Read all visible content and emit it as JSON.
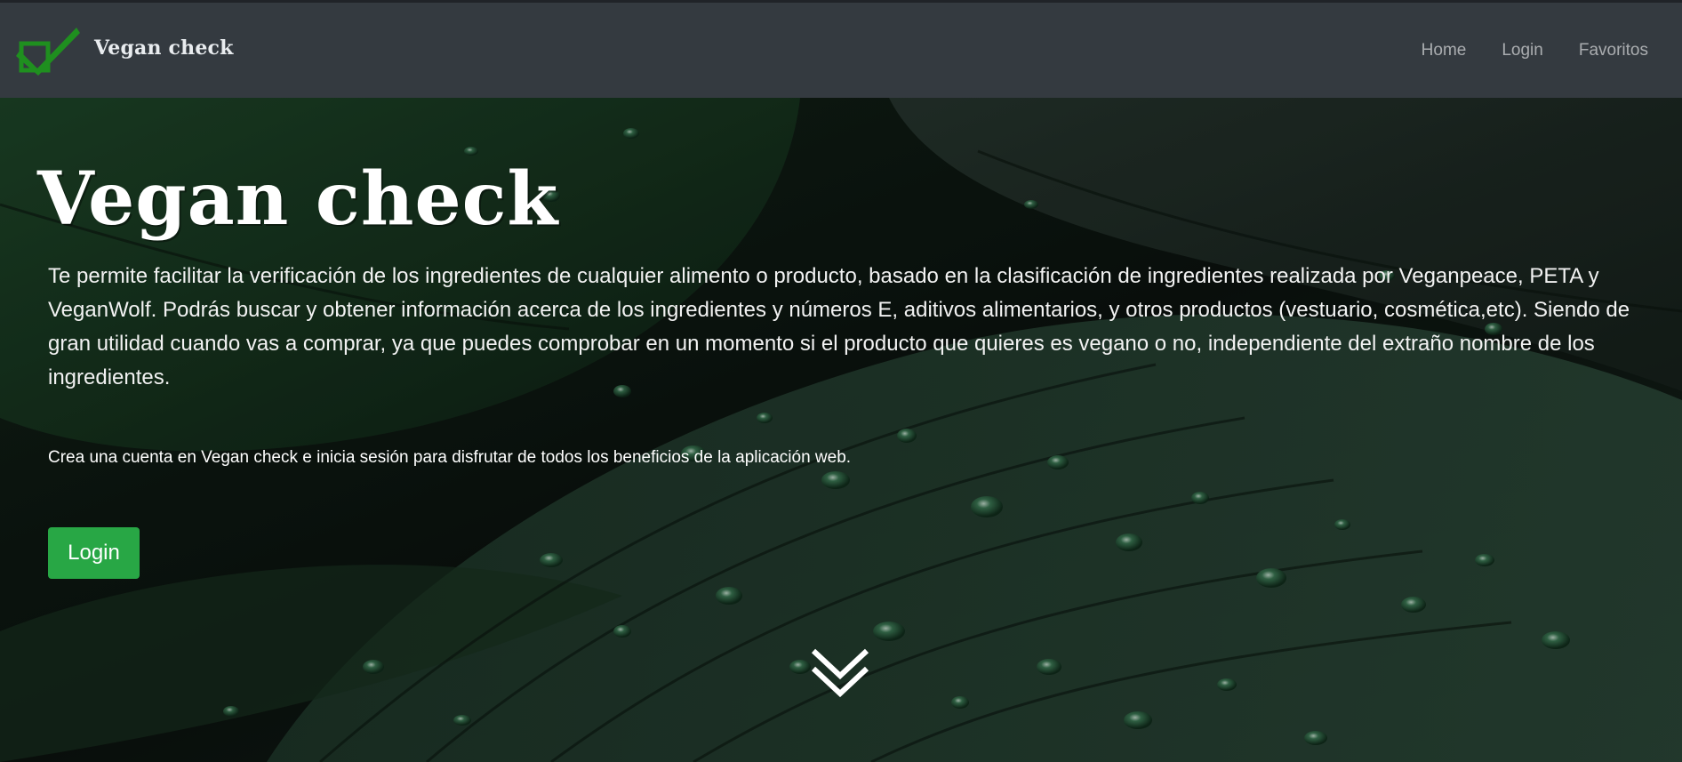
{
  "navbar": {
    "brand_name": "Vegan check",
    "brand_icon": "checkmark-box-icon",
    "links": [
      {
        "label": "Home"
      },
      {
        "label": "Login"
      },
      {
        "label": "Favoritos"
      }
    ]
  },
  "hero": {
    "title": "Vegan check",
    "description": "Te permite facilitar la verificación de los ingredientes de cualquier alimento o producto, basado en la clasificación de ingredientes realizada por Veganpeace, PETA y VeganWolf. Podrás buscar y obtener información acerca de los ingredientes y números E, aditivos alimentarios, y otros productos (vestuario, cosmética,etc). Siendo de gran utilidad cuando vas a comprar, ya que puedes comprobar en un momento si el producto que quieres es vegano o no, independiente del extraño nombre de los ingredientes.",
    "note": "Crea una cuenta en Vegan check e inicia sesión para disfrutar de todos los beneficios de la aplicación web.",
    "login_button": "Login",
    "scroll_icon": "double-chevron-down-icon",
    "background": "dark-green-leaves-with-water-drops"
  },
  "colors": {
    "navbar_bg": "#343a40",
    "accent_green": "#28a745",
    "logo_green": "#1f8f1f"
  }
}
